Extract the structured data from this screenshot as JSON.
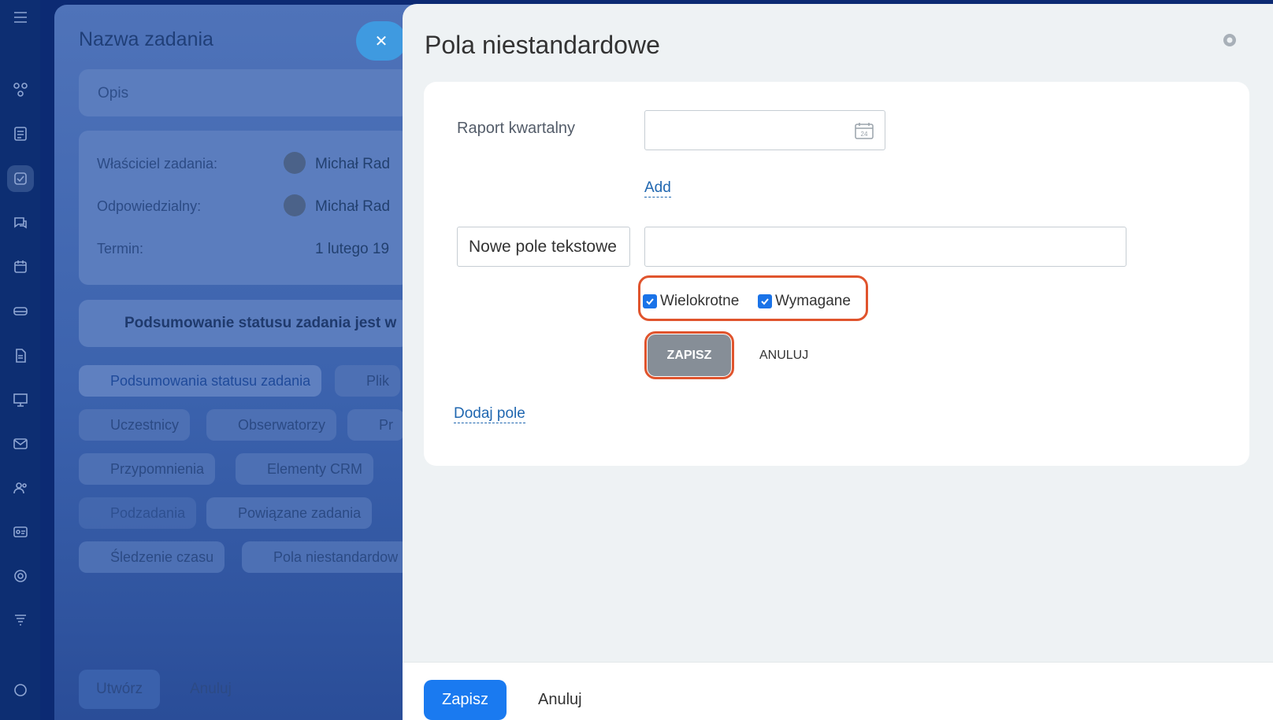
{
  "background": {
    "task_title": "Nazwa zadania",
    "description_placeholder": "Opis",
    "owner_label": "Właściciel zadania:",
    "owner_value": "Michał Rad",
    "responsible_label": "Odpowiedzialny:",
    "responsible_value": "Michał Rad",
    "deadline_label": "Termin:",
    "deadline_value": "1 lutego 19",
    "summary_text": "Podsumowanie statusu zadania jest w",
    "chips": [
      "Podsumowania statusu zadania",
      "Plik",
      "Uczestnicy",
      "Obserwatorzy",
      "Pr",
      "Przypomnienia",
      "Elementy CRM",
      "Podzadania",
      "Powiązane zadania",
      "Śledzenie czasu",
      "Pola niestandardow"
    ],
    "create_button": "Utwórz",
    "cancel_button": "Anuluj"
  },
  "modal": {
    "title": "Pola niestandardowe",
    "report_label": "Raport kwartalny",
    "calendar_day": "24",
    "add_link": "Add",
    "new_field_name": "Nowe pole tekstowe",
    "multiple_label": "Wielokrotne",
    "required_label": "Wymagane",
    "save_small": "ZAPISZ",
    "cancel_small": "ANULUJ",
    "add_field_link": "Dodaj pole",
    "footer_save": "Zapisz",
    "footer_cancel": "Anuluj"
  },
  "colors": {
    "accent": "#1a7af0",
    "highlight": "#e0542d",
    "link": "#2067b0"
  }
}
